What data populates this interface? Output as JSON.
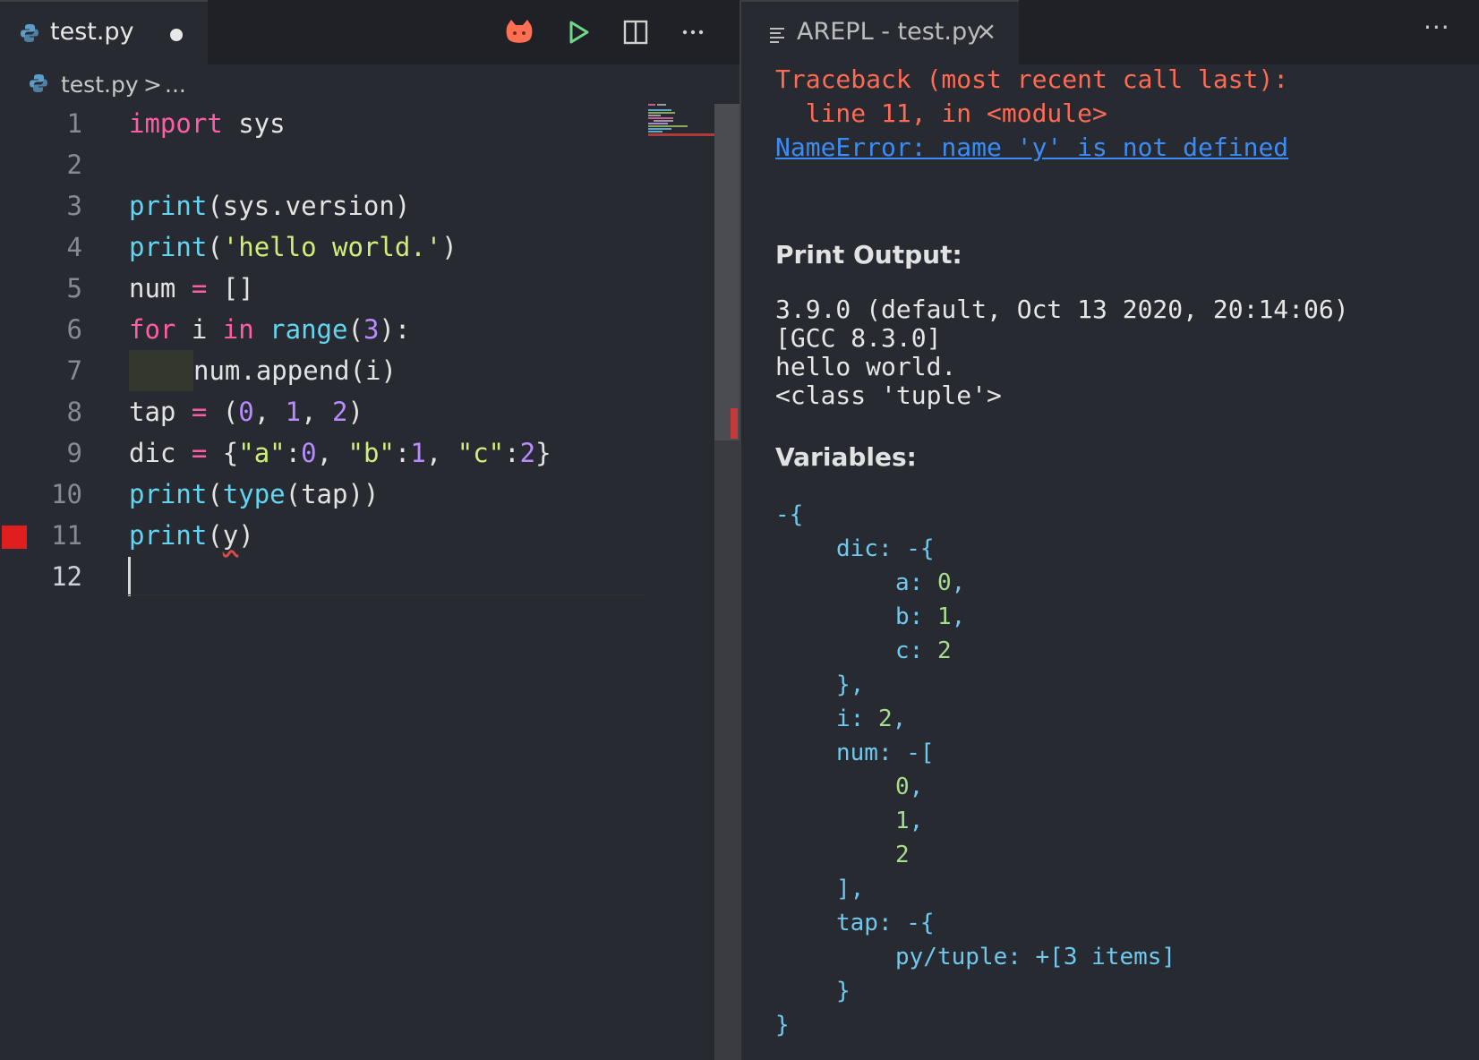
{
  "editor": {
    "tab": {
      "title": "test.py"
    },
    "breadcrumb": {
      "file": "test.py",
      "sep": ">",
      "more": "..."
    },
    "gutter": [
      "1",
      "2",
      "3",
      "4",
      "5",
      "6",
      "7",
      "8",
      "9",
      "10",
      "11",
      "12"
    ],
    "code": {
      "l1": {
        "kw": "import",
        "rest": " sys"
      },
      "l3": {
        "fn": "print",
        "rest": "(sys.version)"
      },
      "l4": {
        "fn": "print",
        "p1": "(",
        "str": "'hello world.'",
        "p2": ")"
      },
      "l5": {
        "a": "num ",
        "op": "=",
        "b": " []"
      },
      "l6": {
        "kw1": "for",
        "a": " i ",
        "kw2": "in",
        "b": " ",
        "fn": "range",
        "c": "(",
        "n": "3",
        "d": "):"
      },
      "l7": {
        "rest": "num.append(i)"
      },
      "l8": {
        "a": "tap ",
        "op": "=",
        "b": " (",
        "n0": "0",
        "c1": ", ",
        "n1": "1",
        "c2": ", ",
        "n2": "2",
        "d": ")"
      },
      "l9": {
        "a": "dic ",
        "op": "=",
        "b": " {",
        "s1": "\"a\"",
        "c1": ":",
        "n1": "0",
        "c2": ", ",
        "s2": "\"b\"",
        "c3": ":",
        "n2": "1",
        "c4": ", ",
        "s3": "\"c\"",
        "c5": ":",
        "n3": "2",
        "d": "}"
      },
      "l10": {
        "fn1": "print",
        "a": "(",
        "fn2": "type",
        "b": "(tap))"
      },
      "l11": {
        "fn": "print",
        "a": "(",
        "y": "y",
        "b": ")"
      }
    }
  },
  "arepl": {
    "tab": {
      "title": "AREPL - test.py",
      "close": "×"
    },
    "more": "···",
    "error": {
      "line1": "Traceback (most recent call last):",
      "line2": "  line 11, in <module>",
      "link": "NameError: name 'y' is not defined"
    },
    "print_heading": "Print Output:",
    "print_output": "3.9.0 (default, Oct 13 2020, 20:14:06)\n[GCC 8.3.0]\nhello world.\n<class 'tuple'>",
    "vars_heading": "Variables:",
    "vars": [
      "-{",
      "dic: -{",
      "a: ",
      "0",
      ",",
      "b: ",
      "1",
      ",",
      "c: ",
      "2",
      "},",
      "i: ",
      "2",
      ",",
      "num: -[",
      "0",
      ",",
      "1",
      ",",
      "2",
      "],",
      "tap: -{",
      "py/tuple: +[3 items]",
      "}",
      "}"
    ]
  },
  "colors": {
    "accent_error": "#ff6a55",
    "link": "#3b8cf5",
    "breakpoint": "#e01e1e"
  }
}
